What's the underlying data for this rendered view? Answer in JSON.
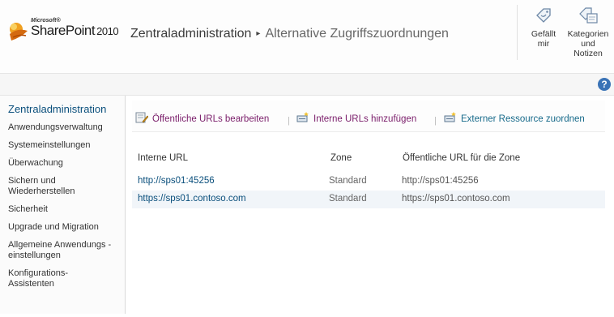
{
  "header": {
    "logo_company": "Microsoft®",
    "logo_product": "SharePoint",
    "logo_version": "2010",
    "breadcrumb_root": "Zentraladministration",
    "breadcrumb_separator": "▸",
    "breadcrumb_current": "Alternative Zugriffszuordnungen",
    "like_label": "Gefällt mir",
    "tags_label": "Kategorien und Notizen",
    "help_glyph": "?"
  },
  "sidebar": {
    "title": "Zentraladministration",
    "items": [
      {
        "label": "Anwendungsverwaltung"
      },
      {
        "label": "Systemeinstellungen"
      },
      {
        "label": "Überwachung"
      },
      {
        "label": "Sichern und Wiederherstellen"
      },
      {
        "label": "Sicherheit"
      },
      {
        "label": "Upgrade und Migration"
      },
      {
        "label": "Allgemeine Anwendungs - einstellungen"
      },
      {
        "label": "Konfigurations-Assistenten"
      }
    ]
  },
  "toolbar": {
    "edit_public_urls": "Öffentliche URLs bearbeiten",
    "add_internal_urls": "Interne URLs hinzufügen",
    "map_external_resource": "Externer Ressource zuordnen",
    "separator": "|"
  },
  "table": {
    "headers": {
      "internal_url": "Interne URL",
      "zone": "Zone",
      "public_url": "Öffentliche URL für die Zone"
    },
    "rows": [
      {
        "internal_url": "http://sps01:45256",
        "zone": "Standard",
        "public_url": "http://sps01:45256"
      },
      {
        "internal_url": "https://sps01.contoso.com",
        "zone": "Standard",
        "public_url": "https://sps01.contoso.com"
      }
    ]
  },
  "colors": {
    "link_blue": "#0a4f7c",
    "action_purple": "#7a1d6a",
    "action_teal": "#176a8a",
    "help_blue": "#3a73b6"
  }
}
